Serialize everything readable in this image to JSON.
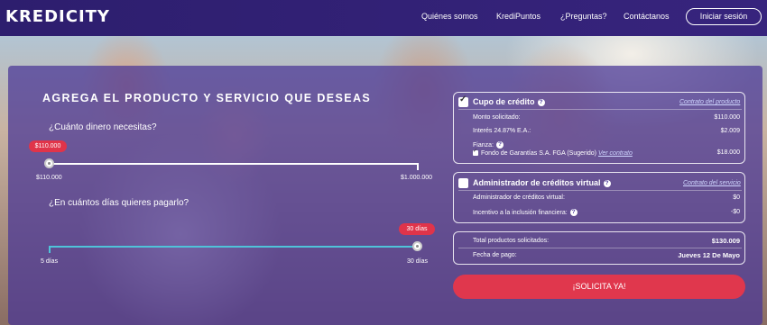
{
  "header": {
    "logo": "KREDICITY",
    "nav": [
      "Quiénes somos",
      "KrediPuntos",
      "¿Preguntas?",
      "Contáctanos"
    ],
    "login": "Iniciar sesión"
  },
  "form": {
    "title": "AGREGA EL PRODUCTO Y SERVICIO QUE DESEAS",
    "amount_question": "¿Cuánto dinero necesitas?",
    "amount_bubble": "$110.000",
    "amount_min": "$110.000",
    "amount_max": "$1.000.000",
    "amount_level": 0.0,
    "days_question": "¿En cuántos días quieres pagarlo?",
    "days_bubble": "30 días",
    "days_min": "5 días",
    "days_max": "30 días",
    "days_level": 1.0
  },
  "credit": {
    "checked": true,
    "title": "Cupo de crédito",
    "contract_link": "Contrato del producto",
    "rows": [
      {
        "label": "Monto solicitado:",
        "value": "$110.000"
      },
      {
        "label": "Interés 24.87% E.A.:",
        "value": "$2.009"
      }
    ],
    "fianza_label": "Fianza:",
    "fianza_option": "Fondo de Garantías S.A. FGA (Sugerido)",
    "fianza_link": "Ver contrato",
    "fianza_value": "$18.000"
  },
  "virtual": {
    "checked": false,
    "title": "Administrador de créditos virtual",
    "contract_link": "Contrato del servicio",
    "rows": [
      {
        "label": "Administrador de créditos virtual:",
        "value": "$0"
      },
      {
        "label": "Incentivo a la inclusión financiera:",
        "value": "-$0"
      }
    ]
  },
  "summary": {
    "total_label": "Total productos solicitados:",
    "total_value": "$130.009",
    "date_label": "Fecha de pago:",
    "date_value": "Jueves 12 De Mayo"
  },
  "cta": "¡SOLICITA YA!",
  "colors": {
    "header": "#2d1e6e",
    "panel": "#4834a0",
    "accent": "#e0374d",
    "slider_days": "#4fc3d9"
  }
}
